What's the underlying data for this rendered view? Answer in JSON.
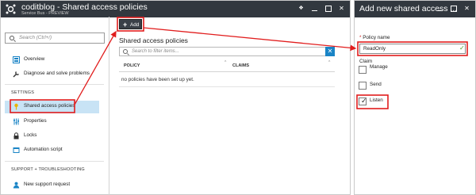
{
  "left_blade": {
    "title": "coditblog - Shared access policies",
    "subtitle": "Service Bus - PREVIEW",
    "controls": {
      "pin": "📌",
      "minimize": "",
      "maximize": "",
      "close": "✕"
    }
  },
  "nav": {
    "search_placeholder": "Search (Ctrl+/)",
    "items": [
      {
        "label": "Overview",
        "icon": "overview-icon"
      },
      {
        "label": "Diagnose and solve problems",
        "icon": "wrench-icon"
      }
    ],
    "settings_header": "SETTINGS",
    "settings_items": [
      {
        "label": "Shared access policies",
        "icon": "key-icon",
        "selected": true
      },
      {
        "label": "Properties",
        "icon": "sliders-icon"
      },
      {
        "label": "Locks",
        "icon": "lock-icon"
      },
      {
        "label": "Automation script",
        "icon": "script-icon"
      }
    ],
    "support_header": "SUPPORT + TROUBLESHOOTING",
    "support_items": [
      {
        "label": "New support request",
        "icon": "person-icon"
      }
    ]
  },
  "main": {
    "add_label": "Add",
    "heading": "Shared access policies",
    "filter_placeholder": "Search to filter items...",
    "columns": [
      "POLICY",
      "CLAIMS"
    ],
    "empty_text": "no policies have been set up yet."
  },
  "right_blade": {
    "title": "Add new shared access ...",
    "controls": {
      "minimize": "",
      "maximize": "",
      "close": "✕"
    },
    "policy_name_label": "Policy name",
    "required_mark": "*",
    "policy_name_value": "ReadOnly",
    "claim_label": "Claim",
    "claims": [
      {
        "label": "Manage",
        "checked": false
      },
      {
        "label": "Send",
        "checked": false
      },
      {
        "label": "Listen",
        "checked": true
      }
    ]
  },
  "colors": {
    "header_bg": "#32383f",
    "selected_bg": "#c8e3f5",
    "accent_blue": "#1a84c6",
    "highlight_red": "#e11d1d",
    "valid_green": "#4a9d2a"
  }
}
